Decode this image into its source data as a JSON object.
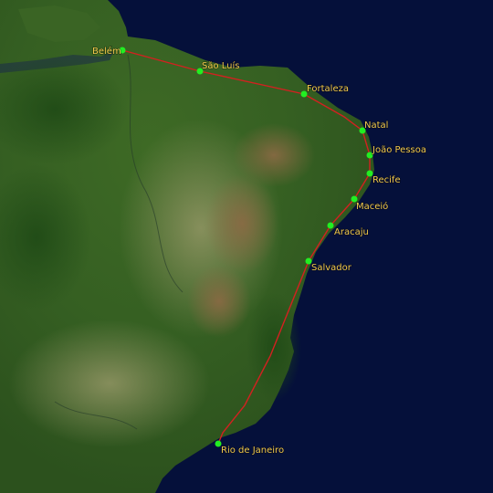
{
  "map": {
    "colors": {
      "ocean": "#05103a",
      "land_dark": "#2f5a1c",
      "land_light": "#7a8a55",
      "route": "#d42020",
      "city_dot": "#22ee22",
      "label": "#f2c94c"
    },
    "cities": [
      {
        "name": "Belém"
      },
      {
        "name": "São Luís"
      },
      {
        "name": "Fortaleza"
      },
      {
        "name": "Natal"
      },
      {
        "name": "João Pessoa"
      },
      {
        "name": "Recife"
      },
      {
        "name": "Maceió"
      },
      {
        "name": "Aracaju"
      },
      {
        "name": "Salvador"
      },
      {
        "name": "Rio de Janeiro"
      }
    ]
  }
}
